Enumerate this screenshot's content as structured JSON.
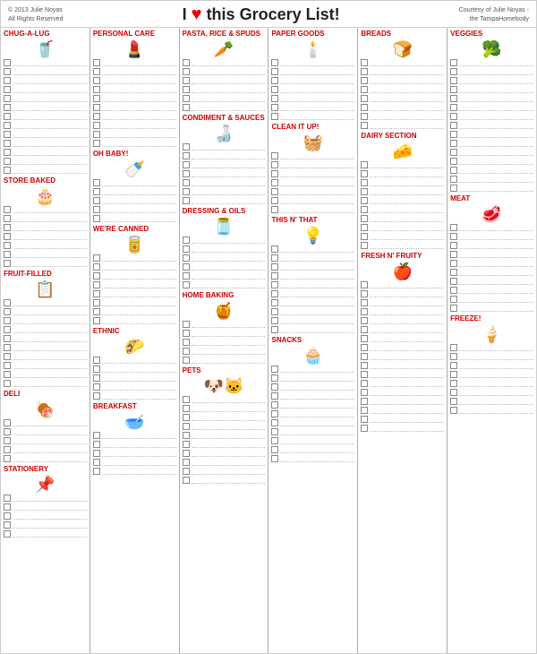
{
  "header": {
    "copyright": "© 2013 Julie Noyas\nAll Rights Reserved",
    "title": "I",
    "heart": "♥",
    "title2": "this Grocery List!",
    "courtesy": "Courtesy of Julie Noyas -\nthe TampaHomebody"
  },
  "columns": [
    {
      "id": "col1",
      "sections": [
        {
          "label": "CHUG-A-LUG",
          "icon": "🥤",
          "lines": 9
        },
        {
          "label": "",
          "icon": "",
          "lines": 4
        },
        {
          "label": "STORE BAKED",
          "icon": "🎂",
          "lines": 7
        },
        {
          "label": "FRUIT-FILLED",
          "icon": "📋",
          "lines": 6
        },
        {
          "label": "",
          "icon": "",
          "lines": 4
        },
        {
          "label": "DELI",
          "icon": "🍖",
          "lines": 5
        },
        {
          "label": "STATIONERY",
          "icon": "📌",
          "lines": 5
        }
      ]
    },
    {
      "id": "col2",
      "sections": [
        {
          "label": "PERSONAL CARE",
          "icon": "💄",
          "lines": 10
        },
        {
          "label": "OH BABY!",
          "icon": "🍼",
          "lines": 5
        },
        {
          "label": "WE'RE CANNED",
          "icon": "🥫",
          "lines": 8
        },
        {
          "label": "ETHNIC",
          "icon": "🌮",
          "lines": 5
        },
        {
          "label": "BREAKFAST",
          "icon": "🥣",
          "lines": 5
        }
      ]
    },
    {
      "id": "col3",
      "sections": [
        {
          "label": "PASTA, RICE & SPUDS",
          "icon": "🥕",
          "lines": 6
        },
        {
          "label": "CONDIMENT & SAUCES",
          "icon": "🍶",
          "lines": 7
        },
        {
          "label": "DRESSING & OILS",
          "icon": "🫙",
          "lines": 6
        },
        {
          "label": "HOME BAKING",
          "icon": "🍯",
          "lines": 5
        },
        {
          "label": "PETS",
          "icon": "🐶🐱",
          "lines": 5
        },
        {
          "label": "",
          "icon": "",
          "lines": 5
        }
      ]
    },
    {
      "id": "col4",
      "sections": [
        {
          "label": "PAPER GOODS",
          "icon": "🕯️",
          "lines": 7
        },
        {
          "label": "CLEAN IT UP!",
          "icon": "🧺",
          "lines": 7
        },
        {
          "label": "THIS N' THAT",
          "icon": "💡",
          "lines": 7
        },
        {
          "label": "",
          "icon": "",
          "lines": 3
        },
        {
          "label": "SNACKS",
          "icon": "🧁",
          "lines": 6
        },
        {
          "label": "",
          "icon": "",
          "lines": 5
        }
      ]
    },
    {
      "id": "col5",
      "sections": [
        {
          "label": "BREADS",
          "icon": "🍞",
          "lines": 8
        },
        {
          "label": "DAIRY SECTION",
          "icon": "🧀",
          "lines": 10
        },
        {
          "label": "FRESH N' FRUITY",
          "icon": "🍎",
          "lines": 10
        },
        {
          "label": "",
          "icon": "",
          "lines": 7
        }
      ]
    },
    {
      "id": "col6",
      "sections": [
        {
          "label": "VEGGIES",
          "icon": "🥦",
          "lines": 10
        },
        {
          "label": "",
          "icon": "",
          "lines": 5
        },
        {
          "label": "MEAT",
          "icon": "🥩",
          "lines": 10
        },
        {
          "label": "FREEZE!",
          "icon": "🍦",
          "lines": 8
        }
      ]
    }
  ]
}
